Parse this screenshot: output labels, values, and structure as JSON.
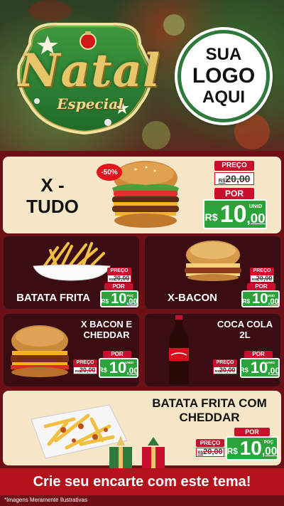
{
  "header": {
    "emblem_title": "Natal",
    "emblem_subtitle": "Especial",
    "logo_line1": "SUA",
    "logo_line2": "LOGO",
    "logo_line3": "AQUI"
  },
  "featured": {
    "name_line1": "X -",
    "name_line2": "TUDO",
    "discount": "-50%",
    "preco_label": "PREÇO",
    "old_currency": "R$",
    "old_price": "20,00",
    "por_label": "POR",
    "currency": "R$",
    "price_int": "10",
    "price_dec": ",00",
    "unit": "UNID"
  },
  "products": [
    {
      "name": "BATATA FRITA",
      "preco_label": "PREÇO",
      "old_currency": "R$",
      "old_price": "20,00",
      "por_label": "POR",
      "currency": "R$",
      "price_int": "10",
      "price_dec": ",00",
      "unit": "POÇ"
    },
    {
      "name": "X-BACON",
      "preco_label": "PREÇO",
      "old_currency": "R$",
      "old_price": "20,00",
      "por_label": "POR",
      "currency": "R$",
      "price_int": "10",
      "price_dec": ",00",
      "unit": "UNID"
    },
    {
      "name_line1": "X BACON E",
      "name_line2": "CHEDDAR",
      "preco_label": "PREÇO",
      "old_currency": "R$",
      "old_price": "20,00",
      "por_label": "POR",
      "currency": "R$",
      "price_int": "10",
      "price_dec": ",00",
      "unit": "UNID"
    },
    {
      "name_line1": "COCA COLA",
      "name_line2": "2L",
      "preco_label": "PREÇO",
      "old_currency": "R$",
      "old_price": "20,00",
      "por_label": "POR",
      "currency": "R$",
      "price_int": "10",
      "price_dec": ",00",
      "unit": "UNID"
    }
  ],
  "bottom": {
    "name_line1": "BATATA FRITA COM",
    "name_line2": "CHEDDAR",
    "preco_label": "PREÇO",
    "old_currency": "R$",
    "old_price": "20,00",
    "por_label": "POR",
    "currency": "R$",
    "price_int": "10",
    "price_dec": ",00",
    "unit": "POÇ"
  },
  "footer": {
    "banner": "Crie seu encarte com este tema!",
    "disclaimer": "*Imagens Meramente Ilustrativas"
  },
  "colors": {
    "background": "#6e0f16",
    "light_card": "#f6e6c8",
    "dark_card": "#3a0d12",
    "price_green": "#2aa43a",
    "tag_red": "#c8102e",
    "banner_red": "#b5121b",
    "gold": "#e7c56a"
  }
}
